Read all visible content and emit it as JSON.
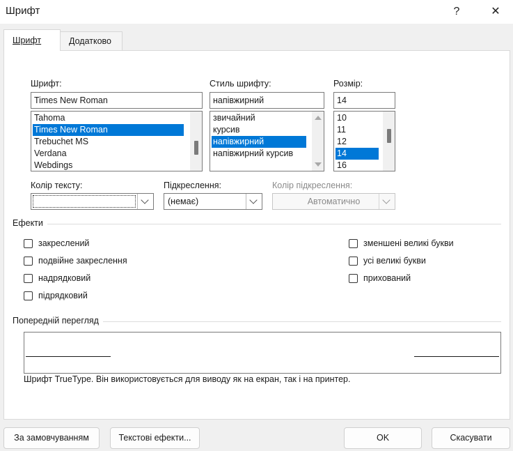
{
  "window": {
    "title": "Шрифт",
    "help_label": "?",
    "close_label": "✕"
  },
  "tabs": [
    {
      "label": "Шрифт",
      "active": true
    },
    {
      "label": "Додатково",
      "active": false
    }
  ],
  "font": {
    "label": "Шрифт:",
    "value": "Times New Roman",
    "items": [
      "Tahoma",
      "Times New Roman",
      "Trebuchet MS",
      "Verdana",
      "Webdings"
    ],
    "selected": "Times New Roman"
  },
  "style": {
    "label": "Стиль шрифту:",
    "value": "напівжирний",
    "items": [
      "звичайний",
      "курсив",
      "напівжирний",
      "напівжирний курсив"
    ],
    "selected": "напівжирний"
  },
  "size": {
    "label": "Розмір:",
    "value": "14",
    "items": [
      "10",
      "11",
      "12",
      "14",
      "16"
    ],
    "selected": "14"
  },
  "text_color": {
    "label": "Колір тексту:",
    "value": ""
  },
  "underline": {
    "label": "Підкреслення:",
    "value": "(немає)"
  },
  "underline_color": {
    "label": "Колір підкреслення:",
    "value": "Автоматично"
  },
  "effects": {
    "title": "Ефекти",
    "left": [
      {
        "label": "закреслений",
        "checked": false
      },
      {
        "label": "подвійне закреслення",
        "checked": false
      },
      {
        "label": "надрядковий",
        "checked": false
      },
      {
        "label": "підрядковий",
        "checked": false
      }
    ],
    "right": [
      {
        "label": "зменшені великі букви",
        "checked": false
      },
      {
        "label": "усі великі букви",
        "checked": false
      },
      {
        "label": "прихований",
        "checked": false
      }
    ]
  },
  "preview": {
    "title": "Попередній перегляд",
    "note": "Шрифт TrueType. Він використовується для виводу як на екран, так і на принтер."
  },
  "buttons": {
    "default": "За замовчуванням",
    "text_effects": "Текстові ефекти...",
    "ok": "OK",
    "cancel": "Скасувати"
  },
  "colors": {
    "accent": "#0078d7",
    "background": "#f0f0f0"
  }
}
